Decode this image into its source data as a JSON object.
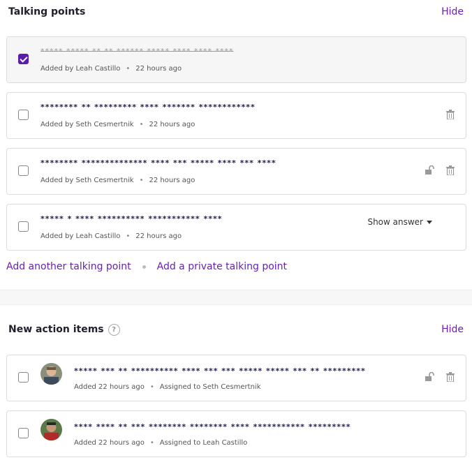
{
  "talking_points": {
    "title": "Talking points",
    "hide_label": "Hide",
    "items": [
      {
        "text": "***** ***** ** ** ****** ***** **** **** ****",
        "meta_added": "Added by Leah Castillo",
        "meta_time": "22 hours ago",
        "checked": true
      },
      {
        "text": "******** ** ********* **** ******* ************",
        "meta_added": "Added by Seth Cesmertnik",
        "meta_time": "22 hours ago",
        "checked": false
      },
      {
        "text": "******** ************** **** *** ***** **** *** ****",
        "meta_added": "Added by Seth Cesmertnik",
        "meta_time": "22 hours ago",
        "checked": false
      },
      {
        "text": "***** * **** ********** *********** ****",
        "meta_added": "Added by Leah Castillo",
        "meta_time": "22 hours ago",
        "checked": false,
        "show_answer_label": "Show answer"
      }
    ],
    "add_link": "Add another talking point",
    "add_private_link": "Add a private talking point"
  },
  "action_items": {
    "title": "New action items",
    "help_glyph": "?",
    "hide_label": "Hide",
    "items": [
      {
        "text": "***** *** ** ********** **** *** *** ***** ***** *** ** *********",
        "meta_added": "Added 22 hours ago",
        "meta_assigned": "Assigned to Seth Cesmertnik",
        "avatar": "seth-avatar"
      },
      {
        "text": "**** **** ** *** ******** ******** **** *********** *********",
        "meta_added": "Added 22 hours ago",
        "meta_assigned": "Assigned to Leah Castillo",
        "avatar": "leah-avatar"
      }
    ]
  },
  "colors": {
    "accent": "#6a1fb8",
    "check": "#5a1dab"
  }
}
